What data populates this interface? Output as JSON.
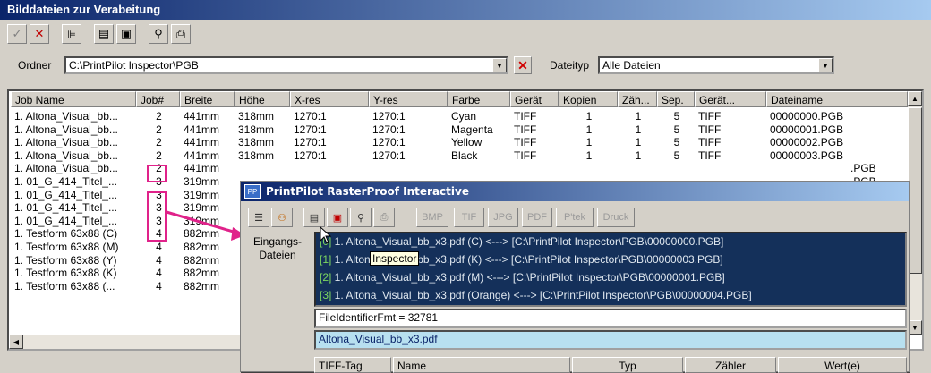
{
  "window": {
    "title": "Bilddateien zur Verabeitung"
  },
  "toolbar": {
    "icons": [
      "check-icon",
      "cross-icon",
      "tree-icon",
      "list-icon",
      "image-icon",
      "zoom-icon",
      "print-icon"
    ]
  },
  "filter": {
    "folder_label": "Ordner",
    "folder_value": "C:\\PrintPilot Inspector\\PGB",
    "filetype_label": "Dateityp",
    "filetype_value": "Alle Dateien"
  },
  "columns": [
    "Job Name",
    "Job#",
    "Breite",
    "Höhe",
    "X-res",
    "Y-res",
    "Farbe",
    "Gerät",
    "Kopien",
    "Zäh...",
    "Sep.",
    "Gerät...",
    "Dateiname"
  ],
  "rows": [
    [
      "1. Altona_Visual_bb...",
      "2",
      "441mm",
      "318mm",
      "1270:1",
      "1270:1",
      "Cyan",
      "TIFF",
      "1",
      "1",
      "5",
      "TIFF",
      "00000000.PGB"
    ],
    [
      "1. Altona_Visual_bb...",
      "2",
      "441mm",
      "318mm",
      "1270:1",
      "1270:1",
      "Magenta",
      "TIFF",
      "1",
      "1",
      "5",
      "TIFF",
      "00000001.PGB"
    ],
    [
      "1. Altona_Visual_bb...",
      "2",
      "441mm",
      "318mm",
      "1270:1",
      "1270:1",
      "Yellow",
      "TIFF",
      "1",
      "1",
      "5",
      "TIFF",
      "00000002.PGB"
    ],
    [
      "1. Altona_Visual_bb...",
      "2",
      "441mm",
      "318mm",
      "1270:1",
      "1270:1",
      "Black",
      "TIFF",
      "1",
      "1",
      "5",
      "TIFF",
      "00000003.PGB"
    ],
    [
      "1. Altona_Visual_bb...",
      "2",
      "441mm",
      "",
      "",
      "",
      "",
      "",
      "",
      "",
      "",
      "",
      ".PGB"
    ],
    [
      "1. 01_G_414_Titel_...",
      "3",
      "319mm",
      "",
      "",
      "",
      "",
      "",
      "",
      "",
      "",
      "",
      ".PGB"
    ],
    [
      "1. 01_G_414_Titel_...",
      "3",
      "319mm",
      "",
      "",
      "",
      "",
      "",
      "",
      "",
      "",
      "",
      ".PGB"
    ],
    [
      "1. 01_G_414_Titel_...",
      "3",
      "319mm",
      "",
      "",
      "",
      "",
      "",
      "",
      "",
      "",
      "",
      ".PGB"
    ],
    [
      "1. 01_G_414_Titel_...",
      "3",
      "319mm",
      "",
      "",
      "",
      "",
      "",
      "",
      "",
      "",
      "",
      ".PGB"
    ],
    [
      "1. Testform 63x88 (C)",
      "4",
      "882mm",
      "",
      "",
      "",
      "",
      "",
      "",
      "",
      "",
      "",
      ".PGB"
    ],
    [
      "1. Testform 63x88 (M)",
      "4",
      "882mm",
      "",
      "",
      "",
      "",
      "",
      "",
      "",
      "",
      "",
      ".PGB"
    ],
    [
      "1. Testform 63x88 (Y)",
      "4",
      "882mm",
      "",
      "",
      "",
      "",
      "",
      "",
      "",
      "",
      "",
      ".PGB"
    ],
    [
      "1. Testform 63x88 (K)",
      "4",
      "882mm",
      "",
      "",
      "",
      "",
      "",
      "",
      "",
      "",
      "",
      ".PGB"
    ],
    [
      "1. Testform 63x88 (...",
      "4",
      "882mm",
      "",
      "",
      "",
      "",
      "",
      "",
      "",
      "",
      "",
      ".PGB"
    ]
  ],
  "dialog": {
    "title": "PrintPilot RasterProof Interactive",
    "buttons": [
      "BMP",
      "TIF",
      "JPG",
      "PDF",
      "P'tek",
      "Druck"
    ],
    "input_label": "Eingangs-\nDateien",
    "tooltip": "Inspector",
    "files": [
      {
        "idx": "[0]",
        "text": " 1. Altona_Visual_bb_x3.pdf (C) <---> [C:\\PrintPilot Inspector\\PGB\\00000000.PGB]"
      },
      {
        "idx": "[1]",
        "text": " 1. Altona_Visual_bb_x3.pdf (K) <---> [C:\\PrintPilot Inspector\\PGB\\00000003.PGB]"
      },
      {
        "idx": "[2]",
        "text": " 1. Altona_Visual_bb_x3.pdf (M) <---> [C:\\PrintPilot Inspector\\PGB\\00000001.PGB]"
      },
      {
        "idx": "[3]",
        "text": " 1. Altona_Visual_bb_x3.pdf (Orange) <---> [C:\\PrintPilot Inspector\\PGB\\00000004.PGB]"
      }
    ],
    "field1": "FileIdentifierFmt = 32781",
    "field2": "Altona_Visual_bb_x3.pdf",
    "table_columns": [
      "TIFF-Tag",
      "Name",
      "Typ",
      "Zähler",
      "Wert(e)"
    ]
  },
  "colors": {
    "titlebar": "#0a246a",
    "highlight": "#e0228a",
    "filelist_bg": "#14305a"
  }
}
